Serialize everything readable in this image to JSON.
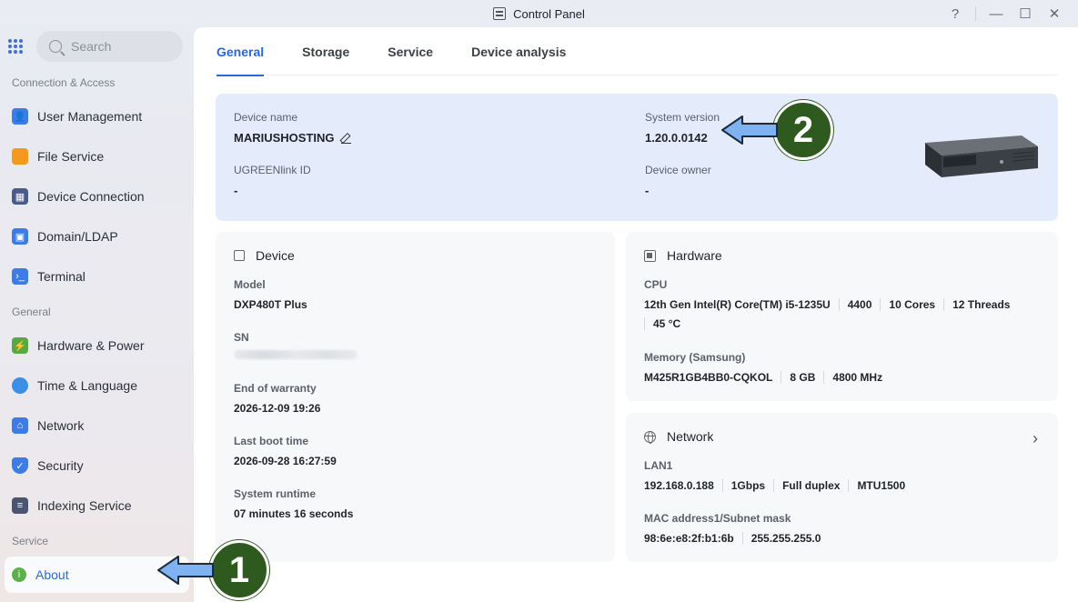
{
  "window": {
    "title": "Control Panel",
    "help_glyph": "?",
    "minimize_glyph": "—",
    "maximize_glyph": "☐",
    "close_glyph": "✕"
  },
  "sidebar": {
    "search_placeholder": "Search",
    "sections": [
      {
        "label": "Connection & Access"
      },
      {
        "label": "General"
      },
      {
        "label": "Service"
      }
    ],
    "items": [
      {
        "label": "User Management",
        "icon": "user-management-icon",
        "color": "#3d7be6"
      },
      {
        "label": "File Service",
        "icon": "folder-icon",
        "color": "#f39a1c"
      },
      {
        "label": "Device Connection",
        "icon": "device-connection-icon",
        "color": "#4a5a8a"
      },
      {
        "label": "Domain/LDAP",
        "icon": "domain-icon",
        "color": "#3d7be6"
      },
      {
        "label": "Terminal",
        "icon": "terminal-icon",
        "color": "#3d7be6"
      },
      {
        "label": "Hardware & Power",
        "icon": "hardware-power-icon",
        "color": "#58a845"
      },
      {
        "label": "Time & Language",
        "icon": "time-language-icon",
        "color": "#3d8fe6"
      },
      {
        "label": "Network",
        "icon": "network-icon",
        "color": "#3d7be6"
      },
      {
        "label": "Security",
        "icon": "shield-icon",
        "color": "#3d7be6"
      },
      {
        "label": "Indexing Service",
        "icon": "indexing-icon",
        "color": "#4a5570"
      },
      {
        "label": "About",
        "icon": "info-icon",
        "color": "#5bb04a",
        "active": true
      }
    ]
  },
  "tabs": [
    {
      "label": "General",
      "active": true
    },
    {
      "label": "Storage"
    },
    {
      "label": "Service"
    },
    {
      "label": "Device analysis"
    }
  ],
  "overview": {
    "device_name_label": "Device name",
    "device_name": "MARIUSHOSTING",
    "ugreenlink_label": "UGREENlink ID",
    "ugreenlink_value": "-",
    "system_version_label": "System version",
    "system_version": "1.20.0.0142",
    "device_owner_label": "Device owner",
    "device_owner_value": "-"
  },
  "device_card": {
    "title": "Device",
    "model_label": "Model",
    "model": "DXP480T Plus",
    "sn_label": "SN",
    "warranty_label": "End of warranty",
    "warranty": "2026-12-09 19:26",
    "boot_label": "Last boot time",
    "boot": "2026-09-28 16:27:59",
    "runtime_label": "System runtime",
    "runtime": "07 minutes 16 seconds"
  },
  "hardware_card": {
    "title": "Hardware",
    "cpu_label": "CPU",
    "cpu_parts": [
      "12th Gen Intel(R) Core(TM) i5-1235U",
      "4400",
      "10 Cores",
      "12 Threads",
      "45 °C"
    ],
    "memory_label": "Memory (Samsung)",
    "memory_parts": [
      "M425R1GB4BB0-CQKOL",
      "8 GB",
      "4800 MHz"
    ]
  },
  "network_card": {
    "title": "Network",
    "lan_label": "LAN1",
    "lan_parts": [
      "192.168.0.188",
      "1Gbps",
      "Full duplex",
      "MTU1500"
    ],
    "mac_label": "MAC address1/Subnet mask",
    "mac_parts": [
      "98:6e:e8:2f:b1:6b",
      "255.255.255.0"
    ]
  },
  "callouts": [
    {
      "number": "1"
    },
    {
      "number": "2"
    }
  ]
}
